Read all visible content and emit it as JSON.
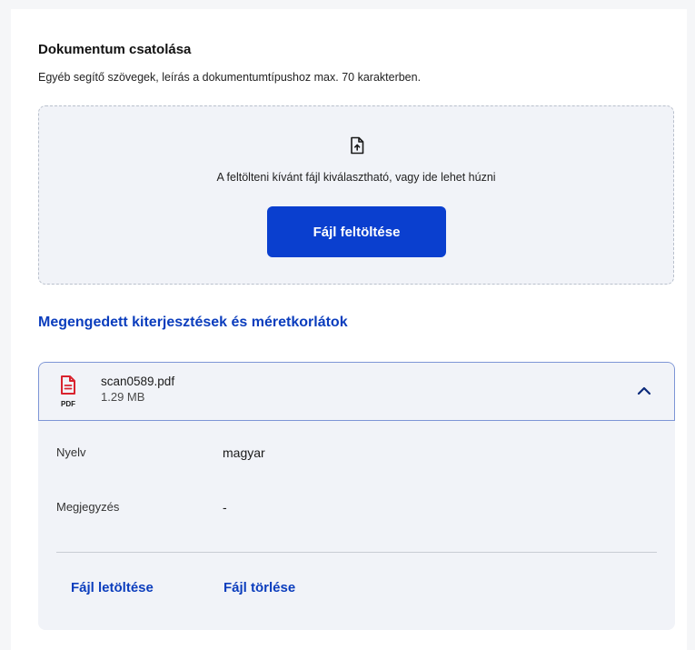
{
  "attach": {
    "title": "Dokumentum csatolása",
    "subtitle": "Egyéb segítő szövegek, leírás a dokumentumtípushoz max. 70 karakterben."
  },
  "dropzone": {
    "icon": "file-upload-icon",
    "text": "A feltölteni kívánt fájl kiválasztható, vagy ide lehet húzni",
    "button_label": "Fájl feltöltése"
  },
  "extensions_link": "Megengedett kiterjesztések és méretkorlátok",
  "file": {
    "icon": "pdf-file-icon",
    "icon_label": "PDF",
    "name": "scan0589.pdf",
    "size": "1.29 MB",
    "expanded": true,
    "details": [
      {
        "label": "Nyelv",
        "value": "magyar"
      },
      {
        "label": "Megjegyzés",
        "value": "-"
      }
    ],
    "download_label": "Fájl letöltése",
    "delete_label": "Fájl törlése"
  },
  "colors": {
    "primary": "#0a3fcf",
    "link": "#0b3dbd",
    "panel_bg": "#f1f3f8",
    "pdf_red": "#d9232e"
  }
}
